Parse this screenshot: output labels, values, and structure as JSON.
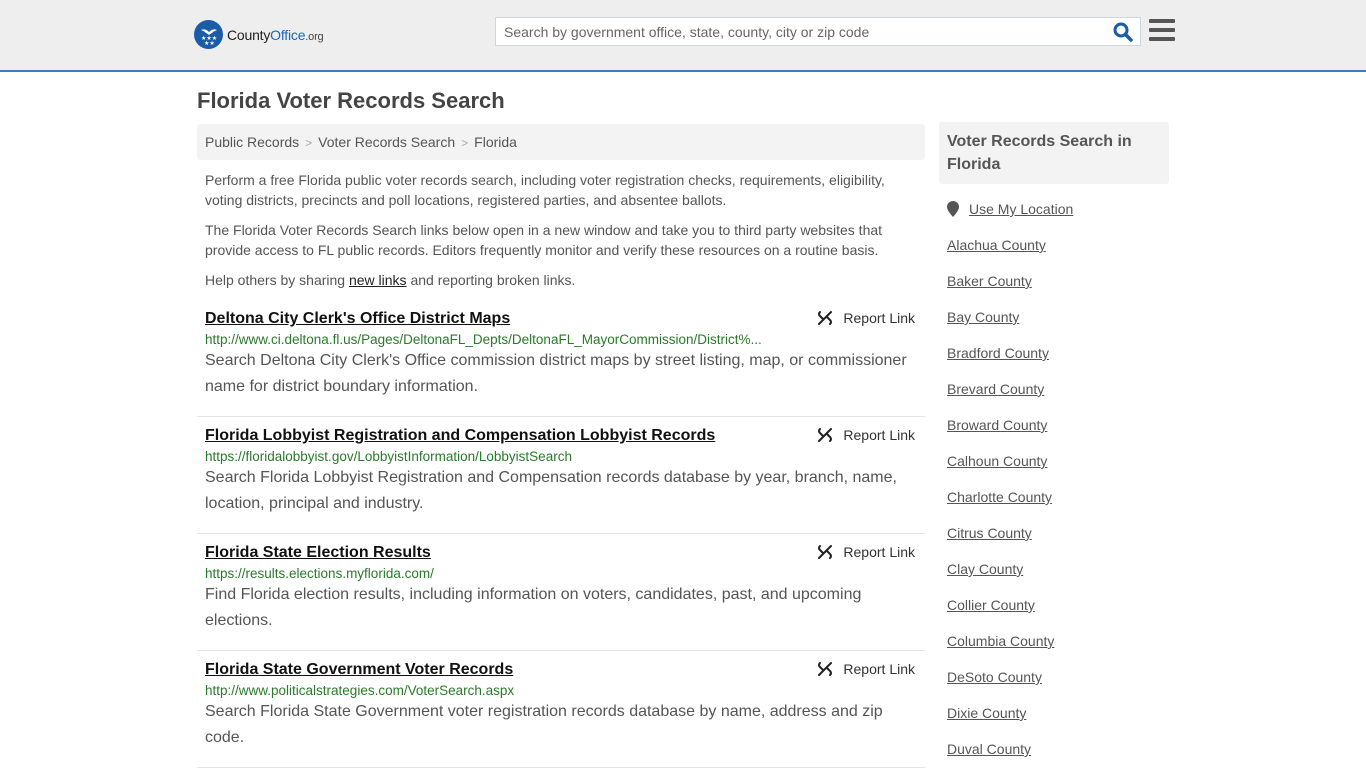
{
  "header": {
    "logo": {
      "brand_part1": "County",
      "brand_part2": "Office",
      "brand_tld": ".org"
    },
    "search": {
      "placeholder": "Search by government office, state, county, city or zip code",
      "value": ""
    },
    "icons": {
      "search": "search-icon",
      "menu": "hamburger-menu-icon"
    }
  },
  "page": {
    "title": "Florida Voter Records Search"
  },
  "breadcrumb": {
    "items": [
      "Public Records",
      "Voter Records Search",
      "Florida"
    ],
    "separator": ">"
  },
  "intro": {
    "p1": "Perform a free Florida public voter records search, including voter registration checks, requirements, eligibility, voting districts, precincts and poll locations, registered parties, and absentee ballots.",
    "p2": "The Florida Voter Records Search links below open in a new window and take you to third party websites that provide access to FL public records. Editors frequently monitor and verify these resources on a routine basis.",
    "p3_before": "Help others by sharing ",
    "p3_link": "new links",
    "p3_after": " and reporting broken links."
  },
  "results": [
    {
      "title": "Deltona City Clerk's Office District Maps",
      "url": "http://www.ci.deltona.fl.us/Pages/DeltonaFL_Depts/DeltonaFL_MayorCommission/District%...",
      "description": "Search Deltona City Clerk's Office commission district maps by street listing, map, or commissioner name for district boundary information.",
      "report_label": "Report Link"
    },
    {
      "title": "Florida Lobbyist Registration and Compensation Lobbyist Records",
      "url": "https://floridalobbyist.gov/LobbyistInformation/LobbyistSearch",
      "description": "Search Florida Lobbyist Registration and Compensation records database by year, branch, name, location, principal and industry.",
      "report_label": "Report Link"
    },
    {
      "title": "Florida State Election Results",
      "url": "https://results.elections.myflorida.com/",
      "description": "Find Florida election results, including information on voters, candidates, past, and upcoming elections.",
      "report_label": "Report Link"
    },
    {
      "title": "Florida State Government Voter Records",
      "url": "http://www.politicalstrategies.com/VoterSearch.aspx",
      "description": "Search Florida State Government voter registration records database by name, address and zip code.",
      "report_label": "Report Link"
    }
  ],
  "sidebar": {
    "heading": "Voter Records Search in Florida",
    "use_location": "Use My Location",
    "counties": [
      "Alachua County",
      "Baker County",
      "Bay County",
      "Bradford County",
      "Brevard County",
      "Broward County",
      "Calhoun County",
      "Charlotte County",
      "Citrus County",
      "Clay County",
      "Collier County",
      "Columbia County",
      "DeSoto County",
      "Dixie County",
      "Duval County"
    ]
  },
  "colors": {
    "brand_blue": "#1a5ca8",
    "header_border": "#3c7ab8",
    "url_green": "#2a7a2a",
    "header_bg": "#eeeeee"
  }
}
